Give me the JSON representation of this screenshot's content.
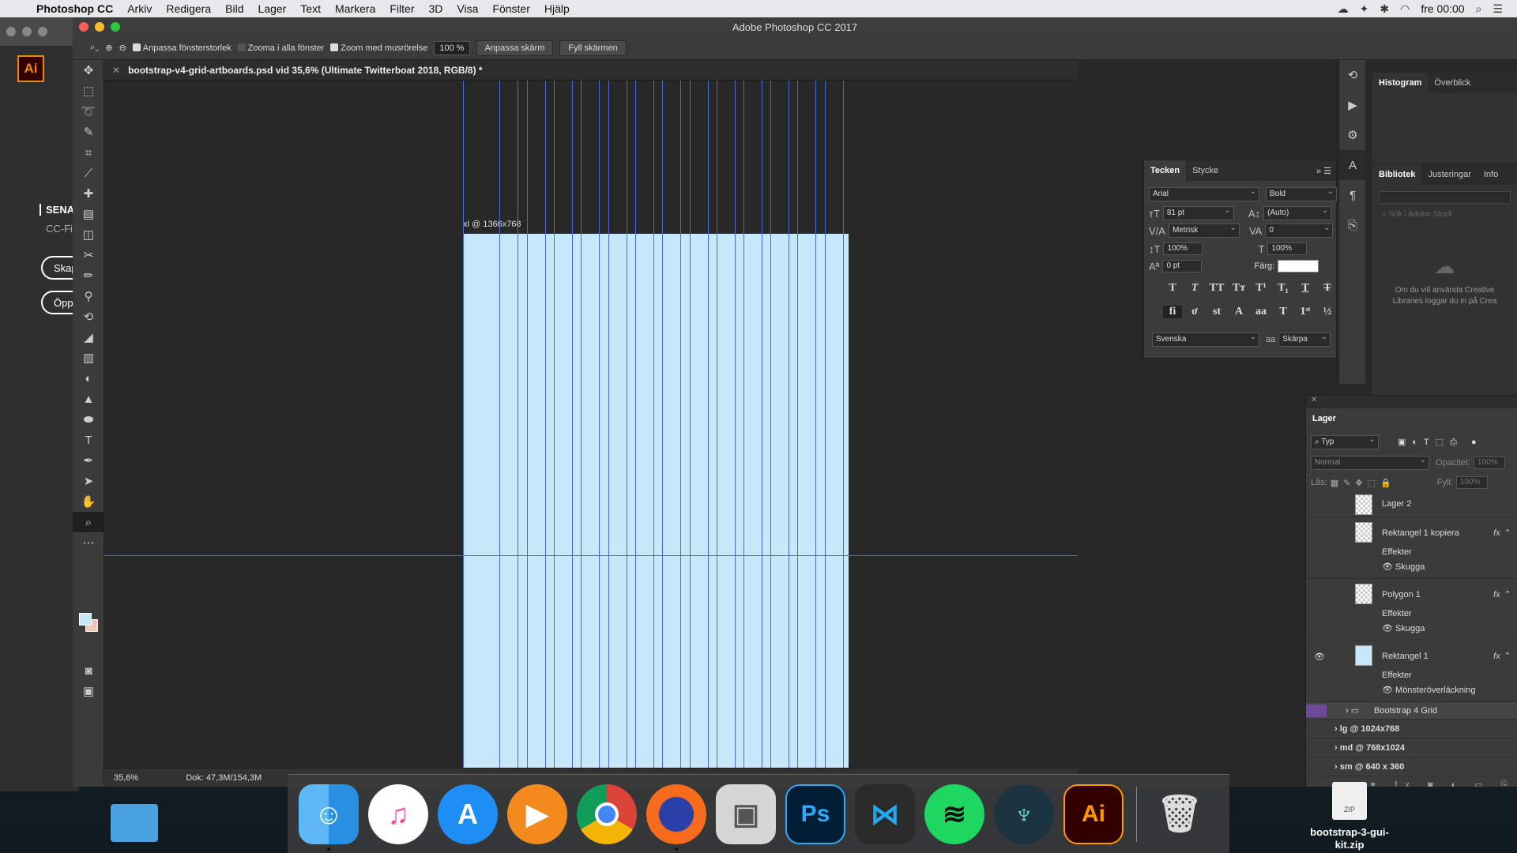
{
  "menubar": {
    "app": "Photoshop CC",
    "menus": [
      "Arkiv",
      "Redigera",
      "Bild",
      "Lager",
      "Text",
      "Markera",
      "Filter",
      "3D",
      "Visa",
      "Fönster",
      "Hjälp"
    ],
    "clock": "fre 00:00"
  },
  "ai_window": {
    "logo": "Ai",
    "heading": "SENA",
    "sub": "CC-Fi",
    "button1": "Skap",
    "button2": "Öpp"
  },
  "window_title": "Adobe Photoshop CC 2017",
  "options": {
    "check1": "Anpassa fönsterstorlek",
    "check2": "Zooma i alla fönster",
    "check3": "Zoom med musrörelse",
    "zoom_value": "100 %",
    "btn_fit": "Anpassa skärm",
    "btn_fill": "Fyll skärmen"
  },
  "document_tab": "bootstrap-v4-grid-artboards.psd vid 35,6% (Ultimate  Twitterboat 2018, RGB/8) *",
  "artboard_label": "xl @ 1366x768",
  "status": {
    "zoom": "35,6%",
    "doc": "Dok: 47,3M/154,3M"
  },
  "right_panel": {
    "tabs_top": [
      "Histogram",
      "Överblick"
    ],
    "tabs_lib": [
      "Bibliotek",
      "Justeringar",
      "Info"
    ],
    "search_placeholder": "Sök i Adobe Stock",
    "lib_msg_1": "Om du vill använda Creative",
    "lib_msg_2": "Libraries loggar du in på Crea"
  },
  "tecken": {
    "tabs": [
      "Tecken",
      "Stycke"
    ],
    "font_family": "Arial",
    "font_style": "Bold",
    "size": "81 pt",
    "leading": "(Auto)",
    "kerning": "Metrisk",
    "tracking": "0",
    "vscale": "100%",
    "hscale": "100%",
    "baseline": "0 pt",
    "color_label": "Färg:",
    "color": "#ffffff",
    "language": "Svenska",
    "aa_label": "aa",
    "antialias": "Skärpa"
  },
  "lager": {
    "title": "Lager",
    "filter": "Typ",
    "blend": "Normal",
    "opacity_label": "Opacitet:",
    "opacity": "100%",
    "lock_label": "Lås:",
    "fill_label": "Fyll:",
    "fill": "100%",
    "layers": [
      {
        "name": "Lager 2"
      },
      {
        "name": "Rektangel 1 kopiera",
        "effects": "Effekter",
        "effect": "Skugga"
      },
      {
        "name": "Polygon 1",
        "effects": "Effekter",
        "effect": "Skugga"
      },
      {
        "name": "Rektangel 1",
        "effects": "Effekter",
        "effect": "Mönsteröverläckning"
      }
    ],
    "groups": [
      "Bootstrap 4 Grid",
      "lg @ 1024x768",
      "md @ 768x1024",
      "sm @ 640 x 360"
    ]
  },
  "dock": {
    "apps": [
      "Finder",
      "iTunes",
      "App Store",
      "Infuse",
      "Chrome",
      "Firefox",
      "Preview",
      "Photoshop",
      "VS Code",
      "Spotify",
      "GitKraken",
      "Illustrator",
      "Trash"
    ],
    "ps_label": "Ps",
    "ai_label": "Ai"
  },
  "desktop": {
    "zip_label": "bootstrap-3-gui-kit.zip",
    "zip_tag": "ZIP"
  }
}
